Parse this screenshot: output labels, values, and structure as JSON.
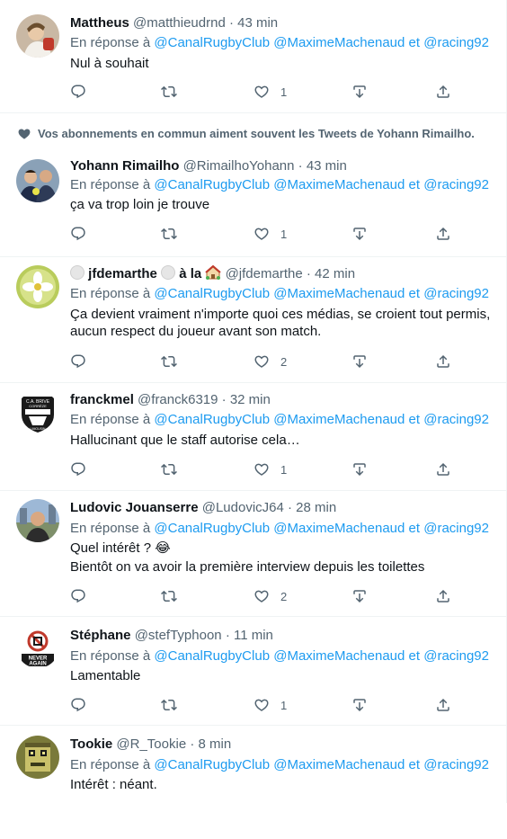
{
  "social_context": {
    "icon": "heart-filled-icon",
    "text": "Vos abonnements en commun aiment souvent les Tweets de Yohann Rimailho."
  },
  "reply_prefix": "En réponse à",
  "reply_to": [
    "@CanalRugbyClub",
    "@MaximeMachenaud",
    "et",
    "@racing92"
  ],
  "tweets": [
    {
      "name": "Mattheus",
      "handle": "@matthieudrnd",
      "time": "· 43 min",
      "lines": [
        "Nul à souhait"
      ],
      "likes": "1"
    },
    {
      "name": "Yohann Rimailho",
      "handle": "@RimailhoYohann",
      "time": "· 43 min",
      "lines": [
        "ça va trop loin je trouve"
      ],
      "likes": "1"
    },
    {
      "name_part1": "jfdemarthe",
      "name_part2": "à la",
      "handle": "@jfdemarthe",
      "time": "· 42 min",
      "lines": [
        "Ça devient vraiment n'importe quoi ces médias, se croient tout permis,",
        "aucun respect du joueur avant son match."
      ],
      "likes": "2"
    },
    {
      "name": "franckmel",
      "handle": "@franck6319",
      "time": "· 32 min",
      "lines": [
        "Hallucinant que le staff autorise cela…"
      ],
      "likes": "1",
      "avatar_text": [
        "C.A. BRIVE",
        "CORRÈZE",
        "LIMOUSIN"
      ]
    },
    {
      "name": "Ludovic Jouanserre",
      "handle": "@LudovicJ64",
      "time": "· 28 min",
      "lines": [
        "Quel intérêt ? 😂",
        "Bientôt on va avoir la première interview depuis les toilettes"
      ],
      "likes": "2"
    },
    {
      "name": "Stéphane",
      "handle": "@stefTyphoon",
      "time": "· 11 min",
      "lines": [
        "Lamentable"
      ],
      "likes": "1",
      "avatar_text": [
        "NEVER",
        "AGAIN"
      ]
    },
    {
      "name": "Tookie",
      "handle": "@R_Tookie",
      "time": "· 8 min",
      "lines": [
        "Intérêt : néant."
      ],
      "likes": ""
    }
  ],
  "icons": {
    "reply": "reply-bubble-icon",
    "retweet": "retweet-icon",
    "like": "heart-outline-icon",
    "download": "download-arrow-icon",
    "share": "share-icon"
  },
  "colors": {
    "link": "#1d9bf0",
    "secondary_text": "#536471",
    "primary_text": "#0f1419",
    "border": "#eff3f4"
  }
}
